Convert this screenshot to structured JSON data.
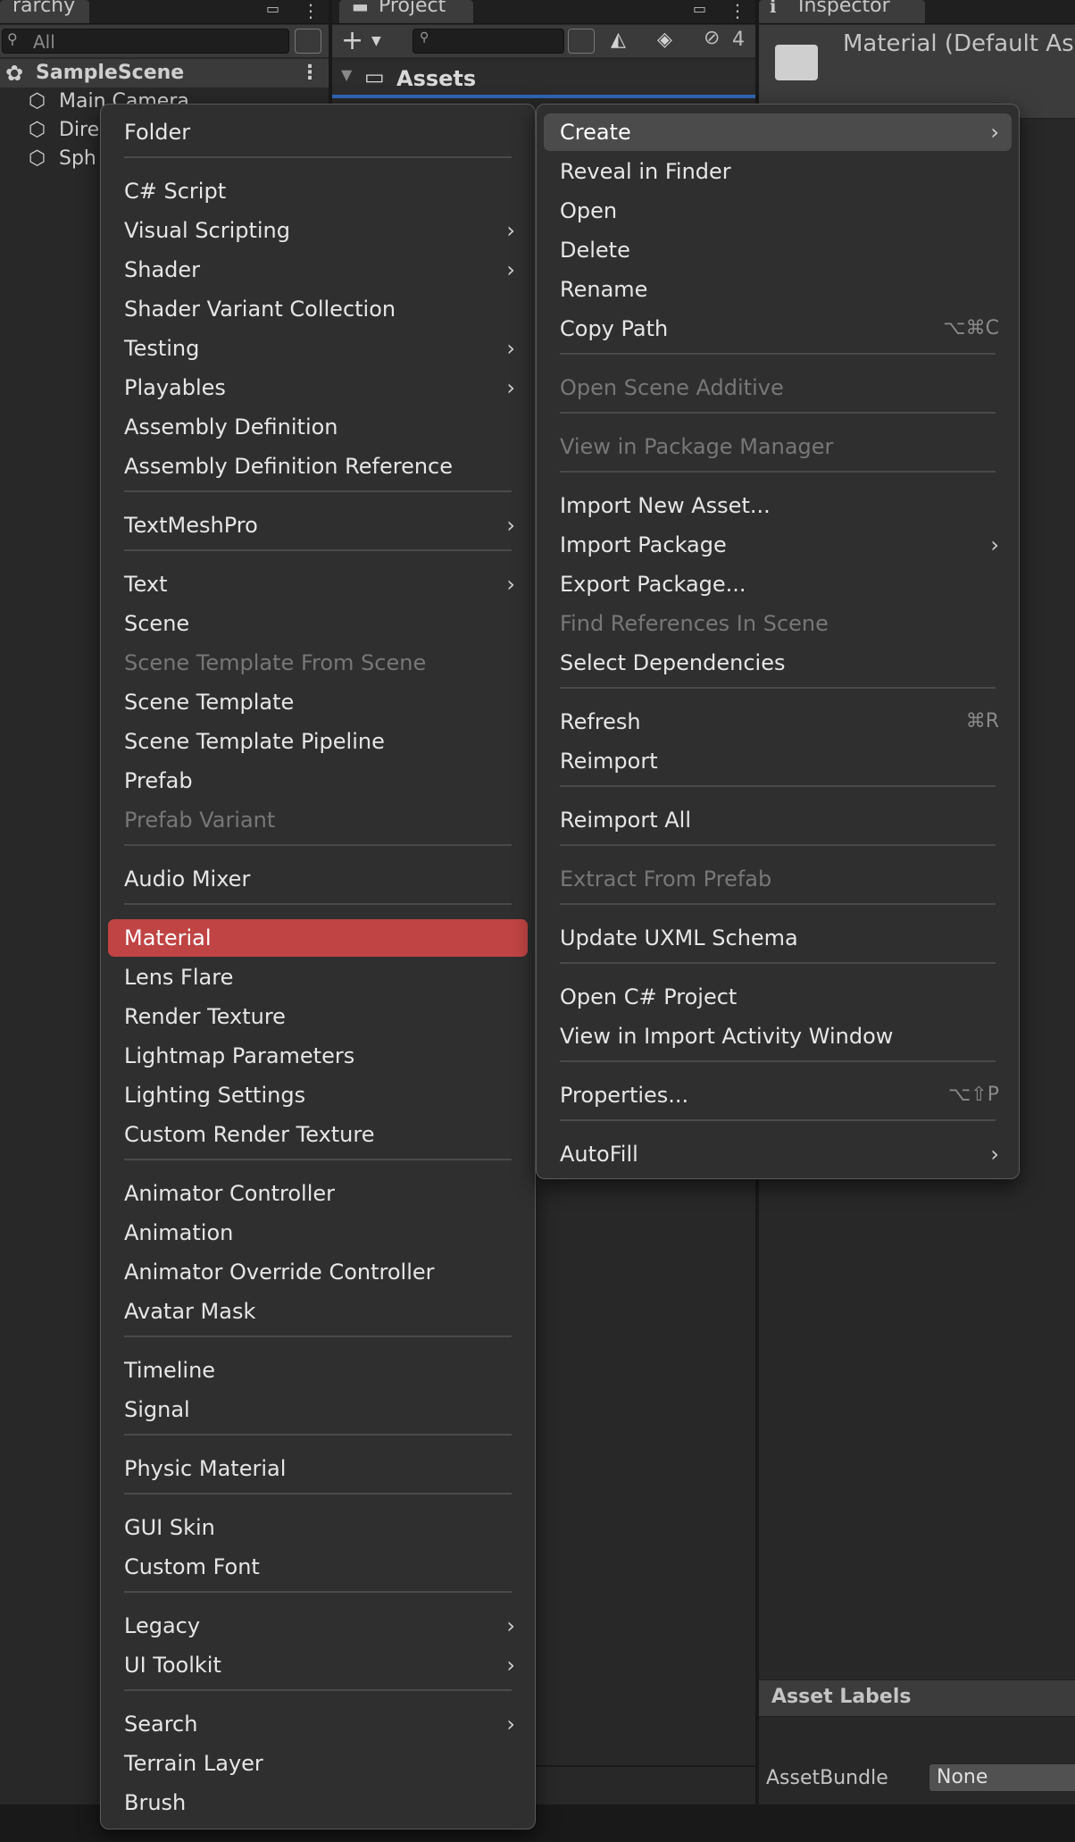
{
  "hierarchy": {
    "tab_label": "rarchy",
    "search_placeholder": "All",
    "scene_name": "SampleScene",
    "objects": [
      "Main Camera",
      "Dire",
      "Sph"
    ]
  },
  "project": {
    "tab_label": "Project",
    "hidden_count": "4",
    "assets_label": "Assets"
  },
  "inspector": {
    "tab_label": "Inspector",
    "title": "Material (Default Ass",
    "asset_labels": "Asset Labels",
    "assetbundle_label": "AssetBundle",
    "assetbundle_value": "None"
  },
  "create_menu": [
    {
      "label": "Folder"
    },
    {
      "sep": true
    },
    {
      "label": "C# Script"
    },
    {
      "label": "Visual Scripting",
      "submenu": true
    },
    {
      "label": "Shader",
      "submenu": true
    },
    {
      "label": "Shader Variant Collection"
    },
    {
      "label": "Testing",
      "submenu": true
    },
    {
      "label": "Playables",
      "submenu": true
    },
    {
      "label": "Assembly Definition"
    },
    {
      "label": "Assembly Definition Reference"
    },
    {
      "sep": true
    },
    {
      "label": "TextMeshPro",
      "submenu": true
    },
    {
      "sep": true
    },
    {
      "label": "Text",
      "submenu": true
    },
    {
      "label": "Scene"
    },
    {
      "label": "Scene Template From Scene",
      "disabled": true
    },
    {
      "label": "Scene Template"
    },
    {
      "label": "Scene Template Pipeline"
    },
    {
      "label": "Prefab"
    },
    {
      "label": "Prefab Variant",
      "disabled": true
    },
    {
      "sep": true
    },
    {
      "label": "Audio Mixer"
    },
    {
      "sep": true
    },
    {
      "label": "Material",
      "highlighted": true
    },
    {
      "label": "Lens Flare"
    },
    {
      "label": "Render Texture"
    },
    {
      "label": "Lightmap Parameters"
    },
    {
      "label": "Lighting Settings"
    },
    {
      "label": "Custom Render Texture"
    },
    {
      "sep": true
    },
    {
      "label": "Animator Controller"
    },
    {
      "label": "Animation"
    },
    {
      "label": "Animator Override Controller"
    },
    {
      "label": "Avatar Mask"
    },
    {
      "sep": true
    },
    {
      "label": "Timeline"
    },
    {
      "label": "Signal"
    },
    {
      "sep": true
    },
    {
      "label": "Physic Material"
    },
    {
      "sep": true
    },
    {
      "label": "GUI Skin"
    },
    {
      "label": "Custom Font"
    },
    {
      "sep": true
    },
    {
      "label": "Legacy",
      "submenu": true
    },
    {
      "label": "UI Toolkit",
      "submenu": true
    },
    {
      "sep": true
    },
    {
      "label": "Search",
      "submenu": true
    },
    {
      "label": "Terrain Layer"
    },
    {
      "label": "Brush"
    }
  ],
  "context_menu": [
    {
      "label": "Create",
      "submenu": true,
      "highlighted": true
    },
    {
      "label": "Reveal in Finder"
    },
    {
      "label": "Open"
    },
    {
      "label": "Delete"
    },
    {
      "label": "Rename"
    },
    {
      "label": "Copy Path",
      "shortcut": "⌥⌘C"
    },
    {
      "sep": true
    },
    {
      "label": "Open Scene Additive",
      "disabled": true
    },
    {
      "sep": true
    },
    {
      "label": "View in Package Manager",
      "disabled": true
    },
    {
      "sep": true
    },
    {
      "label": "Import New Asset..."
    },
    {
      "label": "Import Package",
      "submenu": true
    },
    {
      "label": "Export Package..."
    },
    {
      "label": "Find References In Scene",
      "disabled": true
    },
    {
      "label": "Select Dependencies"
    },
    {
      "sep": true
    },
    {
      "label": "Refresh",
      "shortcut": "⌘R"
    },
    {
      "label": "Reimport"
    },
    {
      "sep": true
    },
    {
      "label": "Reimport All"
    },
    {
      "sep": true
    },
    {
      "label": "Extract From Prefab",
      "disabled": true
    },
    {
      "sep": true
    },
    {
      "label": "Update UXML Schema"
    },
    {
      "sep": true
    },
    {
      "label": "Open C# Project"
    },
    {
      "label": "View in Import Activity Window"
    },
    {
      "sep": true
    },
    {
      "label": "Properties...",
      "shortcut": "⌥⇧P"
    },
    {
      "sep": true
    },
    {
      "label": "AutoFill",
      "submenu": true
    }
  ],
  "icons": {
    "menu_arrow": "›",
    "dots": "⋮",
    "lock": "🔒"
  },
  "colors": {
    "highlight_red": "#c04444",
    "highlight_gray": "#4b4b4b"
  }
}
